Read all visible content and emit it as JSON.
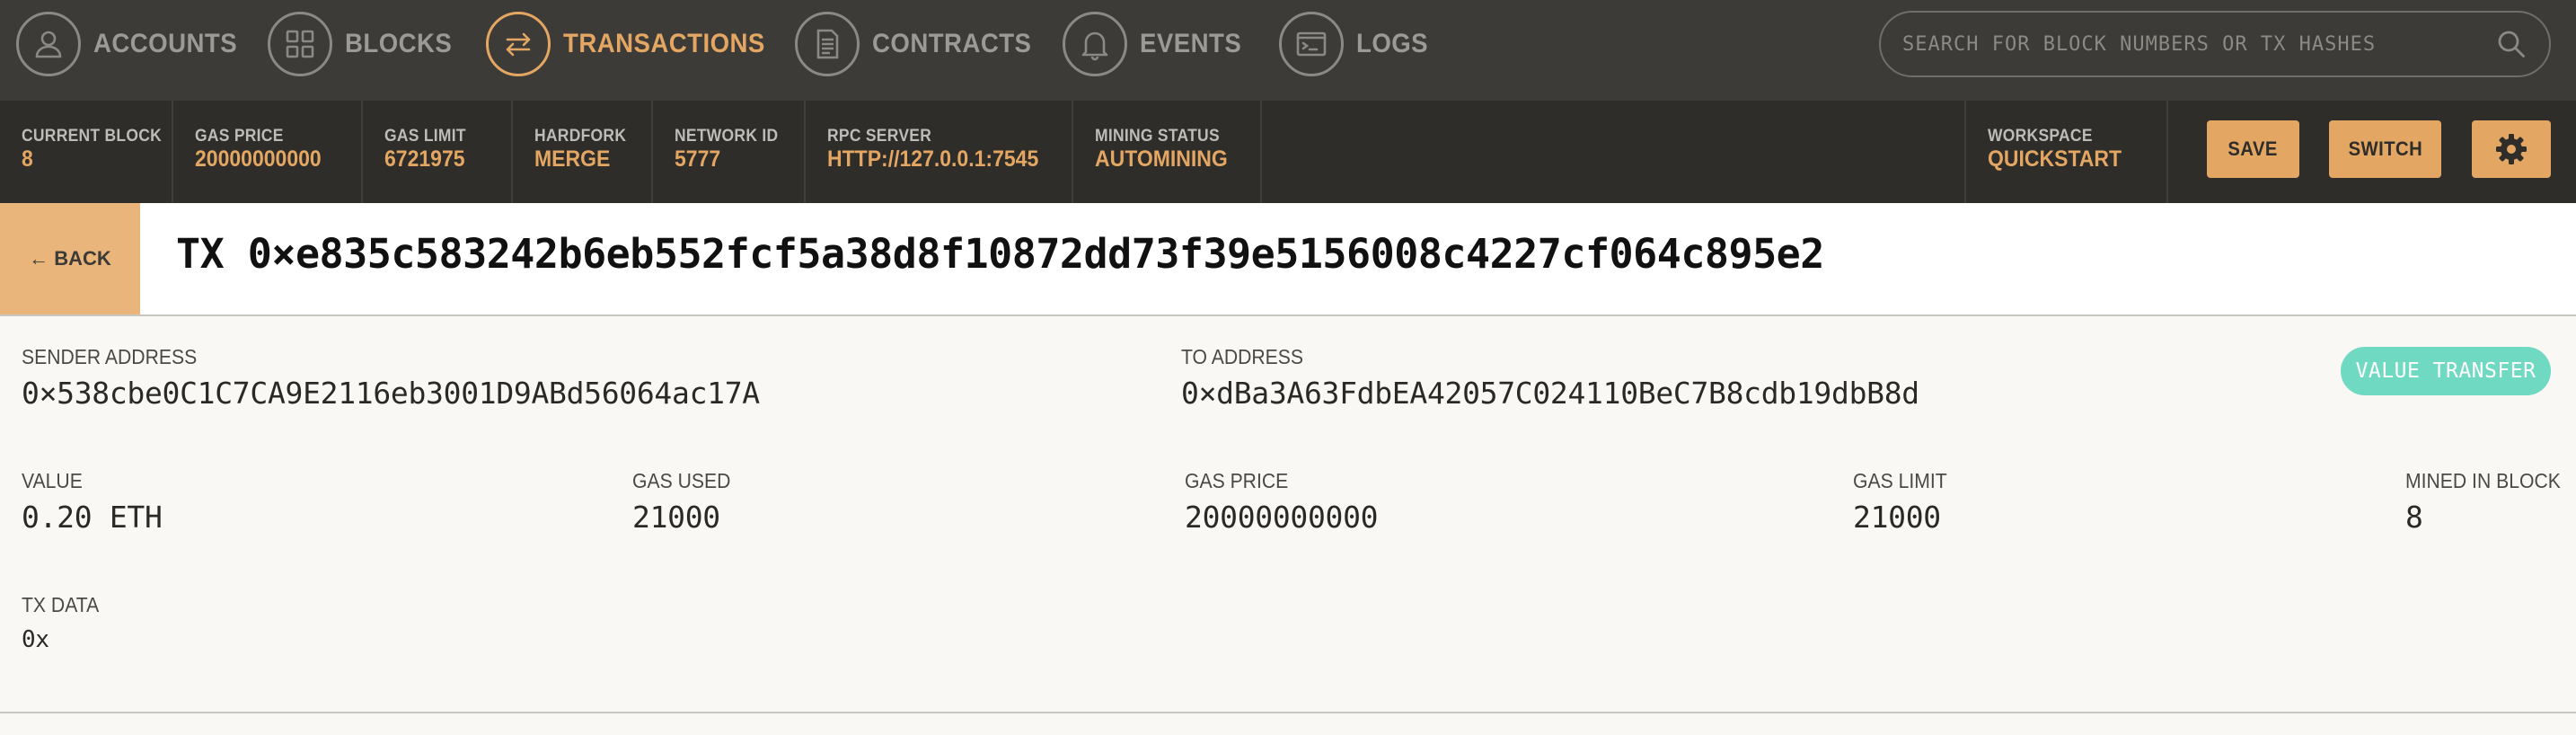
{
  "nav": {
    "items": [
      {
        "label": "ACCOUNTS",
        "icon": "user-icon",
        "active": false
      },
      {
        "label": "BLOCKS",
        "icon": "grid-icon",
        "active": false
      },
      {
        "label": "TRANSACTIONS",
        "icon": "transfer-arrows-icon",
        "active": true
      },
      {
        "label": "CONTRACTS",
        "icon": "document-icon",
        "active": false
      },
      {
        "label": "EVENTS",
        "icon": "bell-icon",
        "active": false
      },
      {
        "label": "LOGS",
        "icon": "terminal-icon",
        "active": false
      }
    ],
    "search_placeholder": "SEARCH FOR BLOCK NUMBERS OR TX HASHES"
  },
  "status": {
    "current_block": {
      "label": "CURRENT BLOCK",
      "value": "8"
    },
    "gas_price": {
      "label": "GAS PRICE",
      "value": "20000000000"
    },
    "gas_limit": {
      "label": "GAS LIMIT",
      "value": "6721975"
    },
    "hardfork": {
      "label": "HARDFORK",
      "value": "MERGE"
    },
    "network_id": {
      "label": "NETWORK ID",
      "value": "5777"
    },
    "rpc_server": {
      "label": "RPC SERVER",
      "value": "HTTP://127.0.0.1:7545"
    },
    "mining_status": {
      "label": "MINING STATUS",
      "value": "AUTOMINING"
    },
    "workspace": {
      "label": "WORKSPACE",
      "value": "QUICKSTART"
    },
    "save_label": "SAVE",
    "switch_label": "SWITCH"
  },
  "tx": {
    "back_label": "← BACK",
    "title": "TX 0×e835c583242b6eb552fcf5a38d8f10872dd73f39e5156008c4227cf064c895e2",
    "sender": {
      "label": "SENDER ADDRESS",
      "value": "0×538cbe0C1C7CA9E2116eb3001D9ABd56064ac17A"
    },
    "to": {
      "label": "TO ADDRESS",
      "value": "0×dBa3A63FdbEA42057C024110BeC7B8cdb19dbB8d"
    },
    "type_badge": "VALUE TRANSFER",
    "value": {
      "label": "VALUE",
      "value": "0.20 ETH"
    },
    "gas_used": {
      "label": "GAS USED",
      "value": "21000"
    },
    "gas_price": {
      "label": "GAS PRICE",
      "value": "20000000000"
    },
    "gas_limit": {
      "label": "GAS LIMIT",
      "value": "21000"
    },
    "mined_in_block": {
      "label": "MINED IN BLOCK",
      "value": "8"
    },
    "tx_data": {
      "label": "TX DATA",
      "value": "0x"
    }
  },
  "colors": {
    "accent": "#e4a663",
    "nav_bg": "#3c3b37",
    "status_bg": "#2e2d29",
    "badge": "#6fd9c2"
  }
}
